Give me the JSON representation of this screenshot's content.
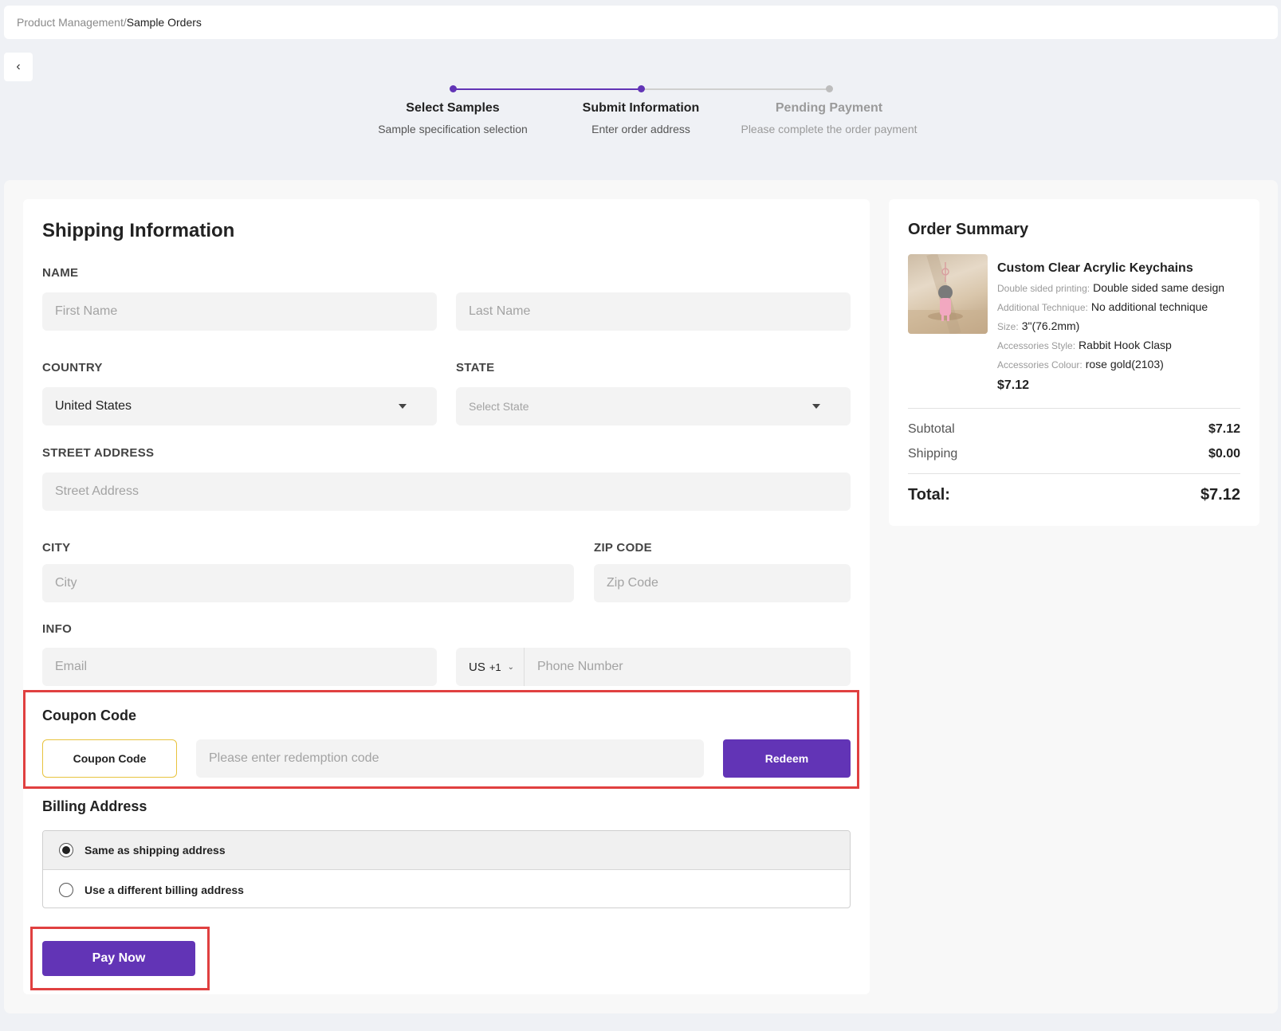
{
  "breadcrumb": {
    "parent": "Product Management/",
    "current": "Sample Orders"
  },
  "steps": [
    {
      "title": "Select Samples",
      "desc": "Sample specification selection"
    },
    {
      "title": "Submit Information",
      "desc": "Enter order address"
    },
    {
      "title": "Pending Payment",
      "desc": "Please complete the order payment"
    }
  ],
  "colors": {
    "accent": "#6234b6",
    "highlight_border": "#e04040",
    "coupon_border": "#e8c33e"
  },
  "shipping": {
    "title": "Shipping Information",
    "name_label": "NAME",
    "first_name_placeholder": "First Name",
    "last_name_placeholder": "Last Name",
    "country_label": "COUNTRY",
    "country_value": "United States",
    "state_label": "STATE",
    "state_placeholder": "Select State",
    "street_label": "STREET ADDRESS",
    "street_placeholder": "Street Address",
    "city_label": "CITY",
    "city_placeholder": "City",
    "zip_label": "ZIP CODE",
    "zip_placeholder": "Zip Code",
    "info_label": "INFO",
    "email_placeholder": "Email",
    "phone_country": "US",
    "phone_code": "+1",
    "phone_placeholder": "Phone Number"
  },
  "coupon": {
    "title": "Coupon Code",
    "toggle_label": "Coupon Code",
    "input_placeholder": "Please enter redemption code",
    "redeem_label": "Redeem"
  },
  "billing": {
    "title": "Billing Address",
    "options": [
      {
        "label": "Same as shipping address",
        "selected": true
      },
      {
        "label": "Use a different billing address",
        "selected": false
      }
    ]
  },
  "pay_button": "Pay Now",
  "summary": {
    "title": "Order Summary",
    "product": {
      "name": "Custom Clear Acrylic Keychains",
      "specs": [
        {
          "key": "Double sided printing:",
          "value": "Double sided same design"
        },
        {
          "key": "Additional Technique:",
          "value": "No additional technique"
        },
        {
          "key": "Size:",
          "value": "3\"(76.2mm)"
        },
        {
          "key": "Accessories Style:",
          "value": "Rabbit Hook Clasp"
        },
        {
          "key": "Accessories Colour:",
          "value": "rose gold(2103)"
        }
      ],
      "price": "$7.12"
    },
    "subtotal_label": "Subtotal",
    "subtotal_value": "$7.12",
    "shipping_label": "Shipping",
    "shipping_value": "$0.00",
    "total_label": "Total:",
    "total_value": "$7.12"
  }
}
